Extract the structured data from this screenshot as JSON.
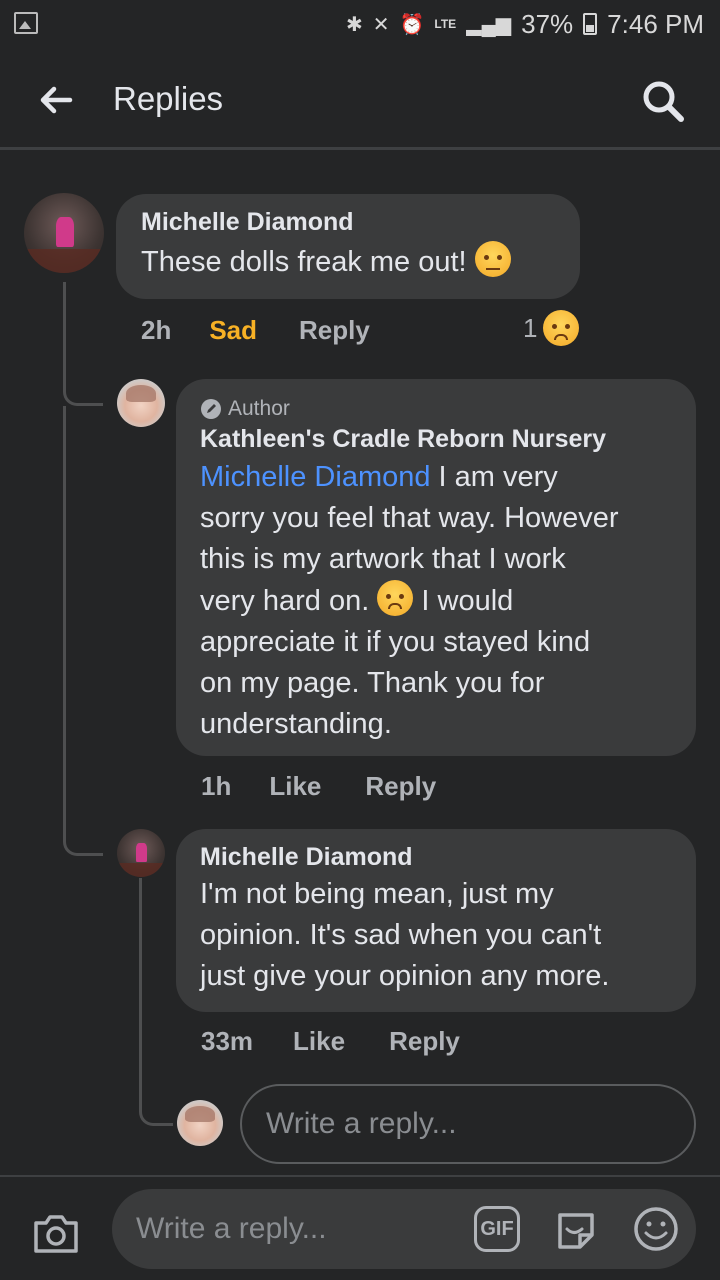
{
  "status_bar": {
    "battery": "37%",
    "time": "7:46 PM",
    "network": "LTE"
  },
  "header": {
    "title": "Replies"
  },
  "comments": [
    {
      "author": "Michelle Diamond",
      "text": "These dolls freak me out! ",
      "emoji": "unamused-face",
      "time": "2h",
      "reaction_label": "Sad",
      "reply_label": "Reply",
      "reaction_count": "1",
      "reaction_icon": "crying-face"
    },
    {
      "badge": "Author",
      "author": "Kathleen's Cradle Reborn Nursery",
      "mention": "Michelle Diamond",
      "lines": [
        " I am very",
        "sorry you feel that way.  However",
        "this is my artwork that I work",
        "very hard on. ",
        " I would",
        "appreciate it if you stayed kind",
        "on my page.  Thank you for",
        "understanding."
      ],
      "emoji": "frowning-face",
      "time": "1h",
      "like_label": "Like",
      "reply_label": "Reply"
    },
    {
      "author": "Michelle Diamond",
      "lines": [
        "I'm not being mean, just my",
        "opinion. It's sad when you can't",
        "just give your opinion any more."
      ],
      "time": "33m",
      "like_label": "Like",
      "reply_label": "Reply"
    }
  ],
  "thread_reply": {
    "placeholder": "Write a reply..."
  },
  "composer": {
    "placeholder": "Write a reply...",
    "gif_label": "GIF"
  },
  "colors": {
    "background": "#242526",
    "bubble": "#3a3b3c",
    "mention": "#4d92ff",
    "sad": "#f7b125",
    "meta": "#b0b3b8"
  }
}
